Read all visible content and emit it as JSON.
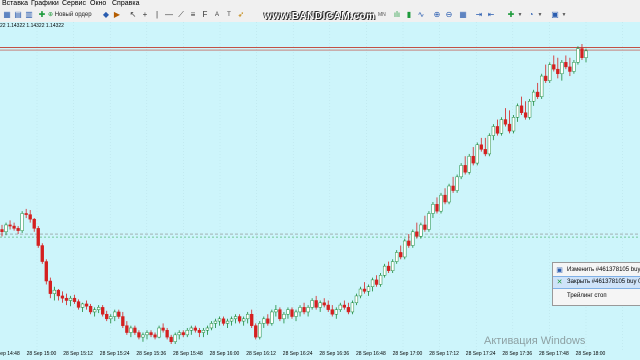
{
  "menu": {
    "items": [
      "Вставка",
      "Графики",
      "Сервис",
      "Окно",
      "Справка"
    ]
  },
  "toolbar": {
    "new_order": "Новый ордер",
    "timeframes": [
      "M1",
      "M5",
      "M15",
      "M30",
      "H1",
      "H4",
      "D1",
      "W1",
      "MN"
    ]
  },
  "bandicam": "www.BANDICAM.com",
  "chart": {
    "ohlc": "22 1.14322 1.14322 1.14322",
    "x_ticks": [
      "28 Sep 14:48",
      "28 Sep 15:00",
      "28 Sep 15:12",
      "28 Sep 15:24",
      "28 Sep 15:36",
      "28 Sep 15:48",
      "28 Sep 16:00",
      "28 Sep 16:12",
      "28 Sep 16:24",
      "28 Sep 16:36",
      "28 Sep 16:48",
      "28 Sep 17:00",
      "28 Sep 17:12",
      "28 Sep 17:24",
      "28 Sep 17:36",
      "28 Sep 17:48",
      "28 Sep 18:00"
    ],
    "colors": {
      "background": "#cdf5fb",
      "bull": "#1a8a3a",
      "bear": "#d42020",
      "ask_line": "#c0392b",
      "order_line": "#888888",
      "grid": "#b8dfe6"
    },
    "candles": [
      [
        100,
        104,
        94,
        98
      ],
      [
        98,
        106,
        95,
        104
      ],
      [
        104,
        108,
        100,
        103
      ],
      [
        103,
        106,
        99,
        101
      ],
      [
        101,
        103,
        96,
        99
      ],
      [
        99,
        116,
        97,
        114
      ],
      [
        114,
        118,
        110,
        113
      ],
      [
        113,
        117,
        106,
        109
      ],
      [
        109,
        110,
        98,
        101
      ],
      [
        101,
        103,
        84,
        86
      ],
      [
        86,
        88,
        70,
        72
      ],
      [
        72,
        74,
        52,
        55
      ],
      [
        55,
        58,
        40,
        44
      ],
      [
        44,
        50,
        38,
        47
      ],
      [
        47,
        48,
        38,
        42
      ],
      [
        42,
        46,
        36,
        40
      ],
      [
        40,
        44,
        34,
        38
      ],
      [
        38,
        42,
        33,
        40
      ],
      [
        40,
        43,
        35,
        37
      ],
      [
        37,
        39,
        30,
        32
      ],
      [
        32,
        36,
        28,
        35
      ],
      [
        35,
        38,
        30,
        33
      ],
      [
        33,
        35,
        26,
        28
      ],
      [
        28,
        32,
        24,
        30
      ],
      [
        30,
        34,
        27,
        32
      ],
      [
        32,
        34,
        24,
        26
      ],
      [
        26,
        29,
        20,
        22
      ],
      [
        22,
        26,
        18,
        24
      ],
      [
        24,
        30,
        20,
        28
      ],
      [
        28,
        30,
        22,
        24
      ],
      [
        24,
        28,
        14,
        16
      ],
      [
        16,
        20,
        8,
        10
      ],
      [
        10,
        16,
        6,
        14
      ],
      [
        14,
        16,
        8,
        10
      ],
      [
        10,
        12,
        4,
        6
      ],
      [
        6,
        10,
        2,
        8
      ],
      [
        8,
        12,
        4,
        10
      ],
      [
        10,
        12,
        6,
        8
      ],
      [
        8,
        10,
        4,
        6
      ],
      [
        6,
        16,
        5,
        14
      ],
      [
        14,
        18,
        10,
        12
      ],
      [
        12,
        14,
        4,
        6
      ],
      [
        6,
        8,
        0,
        2
      ],
      [
        2,
        10,
        0,
        8
      ],
      [
        8,
        12,
        4,
        10
      ],
      [
        10,
        12,
        6,
        8
      ],
      [
        8,
        14,
        6,
        12
      ],
      [
        12,
        16,
        8,
        14
      ],
      [
        14,
        16,
        10,
        12
      ],
      [
        12,
        14,
        6,
        10
      ],
      [
        10,
        14,
        6,
        12
      ],
      [
        12,
        16,
        8,
        14
      ],
      [
        14,
        20,
        12,
        18
      ],
      [
        18,
        22,
        14,
        20
      ],
      [
        20,
        24,
        16,
        22
      ],
      [
        22,
        24,
        16,
        18
      ],
      [
        18,
        22,
        14,
        20
      ],
      [
        20,
        24,
        16,
        22
      ],
      [
        22,
        26,
        18,
        24
      ],
      [
        24,
        26,
        18,
        20
      ],
      [
        20,
        24,
        16,
        22
      ],
      [
        22,
        28,
        18,
        26
      ],
      [
        26,
        30,
        14,
        16
      ],
      [
        16,
        18,
        4,
        6
      ],
      [
        6,
        20,
        4,
        18
      ],
      [
        18,
        24,
        14,
        22
      ],
      [
        22,
        26,
        16,
        18
      ],
      [
        18,
        30,
        16,
        28
      ],
      [
        28,
        34,
        24,
        30
      ],
      [
        30,
        32,
        20,
        22
      ],
      [
        22,
        28,
        18,
        26
      ],
      [
        26,
        32,
        22,
        30
      ],
      [
        30,
        32,
        22,
        24
      ],
      [
        24,
        30,
        20,
        28
      ],
      [
        28,
        34,
        24,
        32
      ],
      [
        32,
        36,
        26,
        28
      ],
      [
        28,
        34,
        24,
        32
      ],
      [
        32,
        40,
        30,
        38
      ],
      [
        38,
        42,
        30,
        32
      ],
      [
        32,
        38,
        28,
        36
      ],
      [
        36,
        40,
        32,
        34
      ],
      [
        34,
        38,
        28,
        30
      ],
      [
        30,
        34,
        24,
        26
      ],
      [
        26,
        32,
        22,
        30
      ],
      [
        30,
        36,
        28,
        34
      ],
      [
        34,
        38,
        30,
        32
      ],
      [
        32,
        36,
        26,
        28
      ],
      [
        28,
        38,
        26,
        36
      ],
      [
        36,
        44,
        34,
        42
      ],
      [
        42,
        50,
        40,
        48
      ],
      [
        48,
        54,
        44,
        46
      ],
      [
        46,
        52,
        42,
        50
      ],
      [
        50,
        58,
        46,
        56
      ],
      [
        56,
        60,
        50,
        52
      ],
      [
        52,
        62,
        50,
        60
      ],
      [
        60,
        70,
        58,
        68
      ],
      [
        68,
        72,
        62,
        64
      ],
      [
        64,
        74,
        62,
        72
      ],
      [
        72,
        82,
        70,
        80
      ],
      [
        80,
        86,
        74,
        76
      ],
      [
        76,
        92,
        74,
        90
      ],
      [
        90,
        96,
        84,
        86
      ],
      [
        86,
        100,
        84,
        98
      ],
      [
        98,
        106,
        92,
        94
      ],
      [
        94,
        106,
        92,
        104
      ],
      [
        104,
        112,
        98,
        100
      ],
      [
        100,
        116,
        98,
        114
      ],
      [
        114,
        124,
        110,
        122
      ],
      [
        122,
        128,
        114,
        116
      ],
      [
        116,
        132,
        114,
        130
      ],
      [
        130,
        136,
        122,
        124
      ],
      [
        124,
        140,
        122,
        138
      ],
      [
        138,
        146,
        132,
        134
      ],
      [
        134,
        148,
        132,
        146
      ],
      [
        146,
        158,
        144,
        156
      ],
      [
        156,
        164,
        148,
        150
      ],
      [
        150,
        166,
        148,
        164
      ],
      [
        164,
        172,
        156,
        158
      ],
      [
        158,
        176,
        156,
        174
      ],
      [
        174,
        180,
        168,
        170
      ],
      [
        170,
        180,
        164,
        166
      ],
      [
        166,
        184,
        164,
        182
      ],
      [
        182,
        192,
        178,
        190
      ],
      [
        190,
        196,
        182,
        184
      ],
      [
        184,
        198,
        182,
        196
      ],
      [
        196,
        206,
        190,
        192
      ],
      [
        192,
        204,
        184,
        186
      ],
      [
        186,
        200,
        184,
        198
      ],
      [
        198,
        210,
        194,
        208
      ],
      [
        208,
        216,
        200,
        202
      ],
      [
        202,
        212,
        196,
        198
      ],
      [
        198,
        214,
        196,
        212
      ],
      [
        212,
        222,
        208,
        220
      ],
      [
        220,
        228,
        214,
        216
      ],
      [
        216,
        236,
        214,
        234
      ],
      [
        234,
        244,
        228,
        230
      ],
      [
        230,
        246,
        228,
        244
      ],
      [
        244,
        252,
        238,
        240
      ],
      [
        240,
        250,
        232,
        236
      ],
      [
        236,
        248,
        230,
        246
      ],
      [
        246,
        252,
        240,
        242
      ],
      [
        242,
        250,
        234,
        238
      ],
      [
        238,
        248,
        236,
        246
      ],
      [
        246,
        260,
        244,
        258
      ],
      [
        258,
        262,
        248,
        250
      ],
      [
        250,
        258,
        246,
        256
      ]
    ],
    "price_levels": {
      "min": 0,
      "max": 262,
      "current": 258,
      "order": 96
    }
  },
  "context_menu": {
    "items": [
      "Изменить #461378105 buy 0.",
      "Закрыть #461378105 buy 0.",
      "Трейлинг стоп"
    ],
    "selected_index": 1
  },
  "watermark": "Активация Windows"
}
